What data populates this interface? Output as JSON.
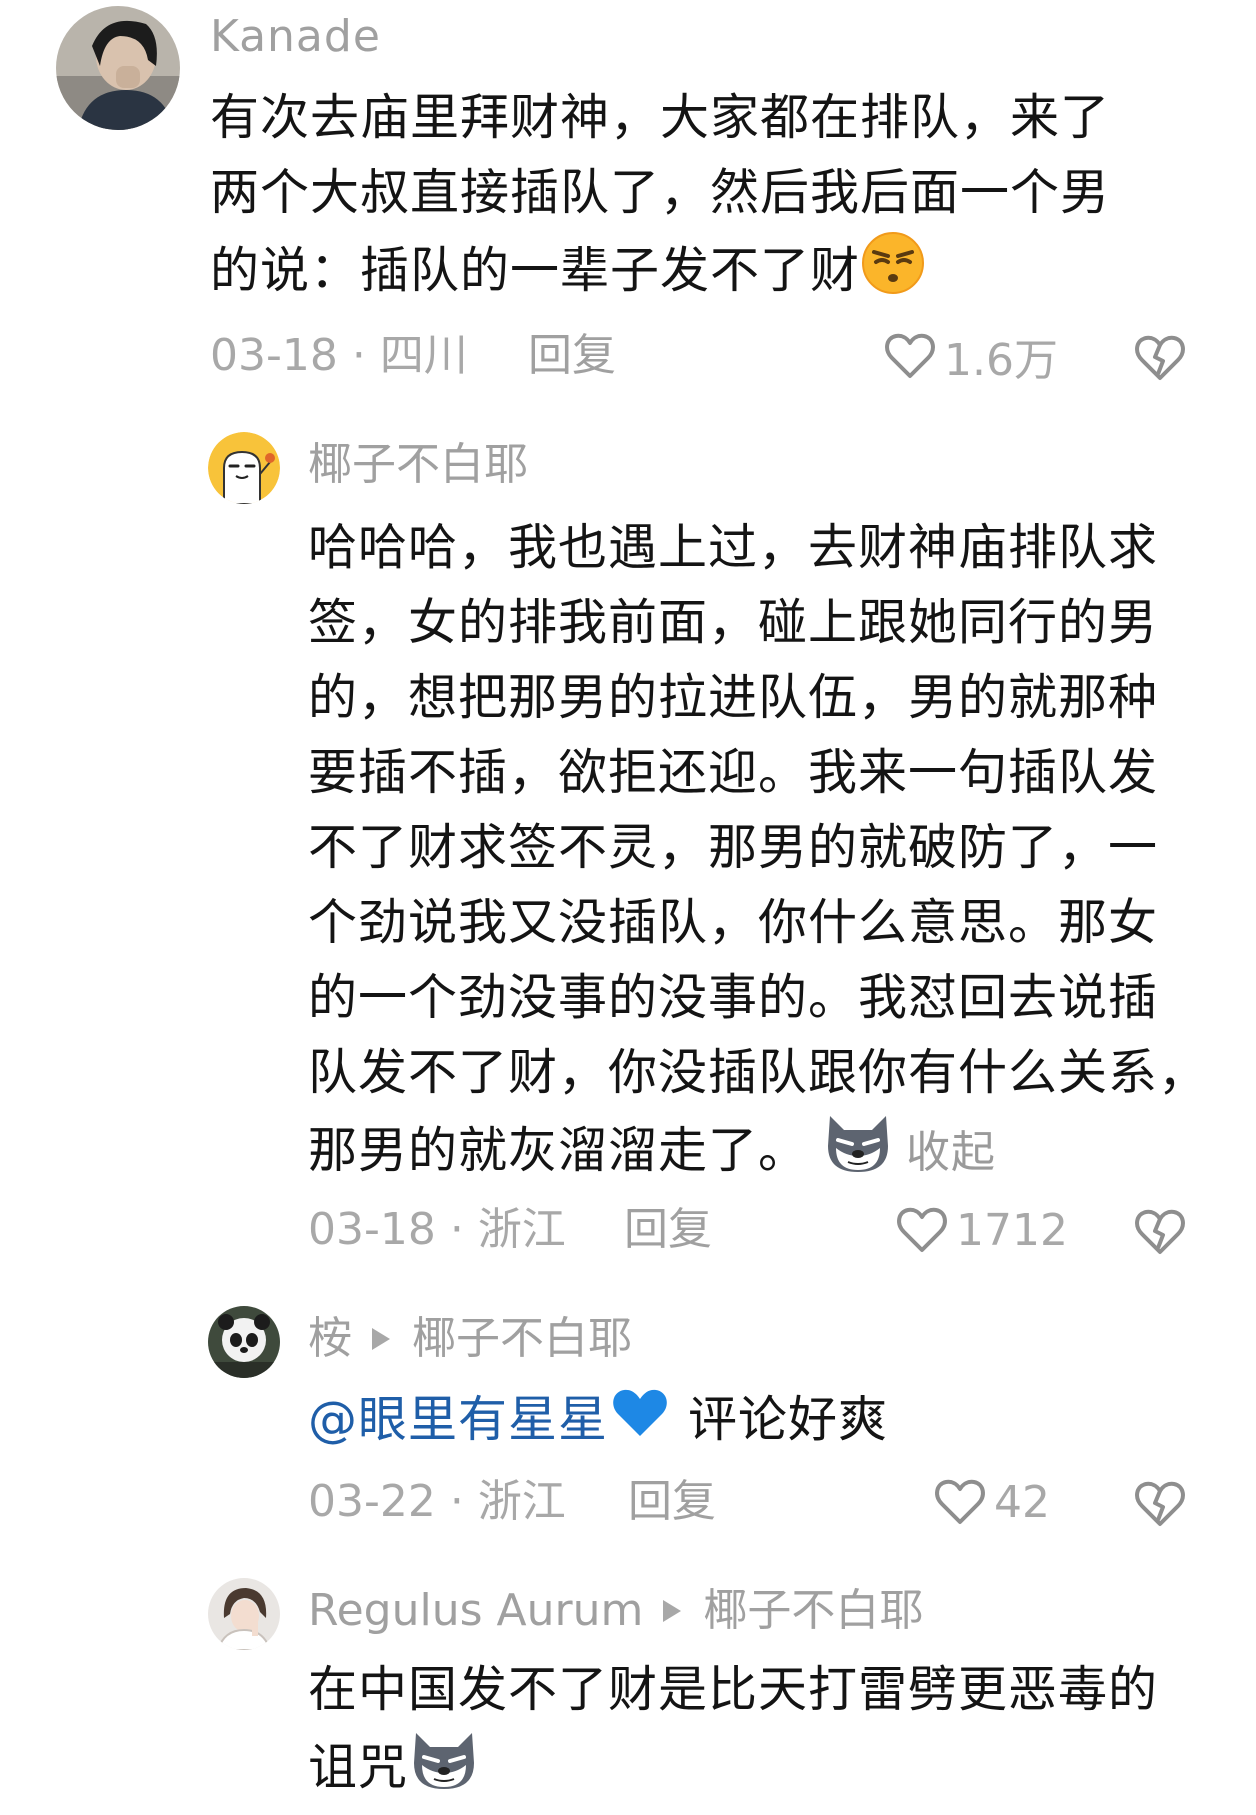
{
  "comments": [
    {
      "username": "Kanade",
      "lines": [
        "有次去庙里拜财神，大家都在排队，来了",
        "两个大叔直接插队了，然后我后面一个男",
        "的说：插队的一辈子发不了财"
      ],
      "date": "03-18 · 四川",
      "reply": "回复",
      "likes": "1.6万"
    },
    {
      "username": "椰子不白耶",
      "lines": [
        "哈哈哈，我也遇上过，去财神庙排队求",
        "签，女的排我前面，碰上跟她同行的男",
        "的，想把那男的拉进队伍，男的就那种",
        "要插不插，欲拒还迎。我来一句插队发",
        "不了财求签不灵，那男的就破防了，一",
        "个劲说我又没插队，你什么意思。那女",
        "的一个劲没事的没事的。我怼回去说插",
        "队发不了财，你没插队跟你有什么关系，",
        "那男的就灰溜溜走了。"
      ],
      "collapse": "收起",
      "date": "03-18 · 浙江",
      "reply": "回复",
      "likes": "1712"
    },
    {
      "username": "桉",
      "reply_to": "椰子不白耶",
      "mention": "@眼里有星星",
      "text_after": "评论好爽",
      "date": "03-22 · 浙江",
      "reply": "回复",
      "likes": "42"
    },
    {
      "username": "Regulus Aurum",
      "reply_to": "椰子不白耶",
      "lines": [
        "在中国发不了财是比天打雷劈更恶毒的",
        "诅咒"
      ]
    }
  ]
}
